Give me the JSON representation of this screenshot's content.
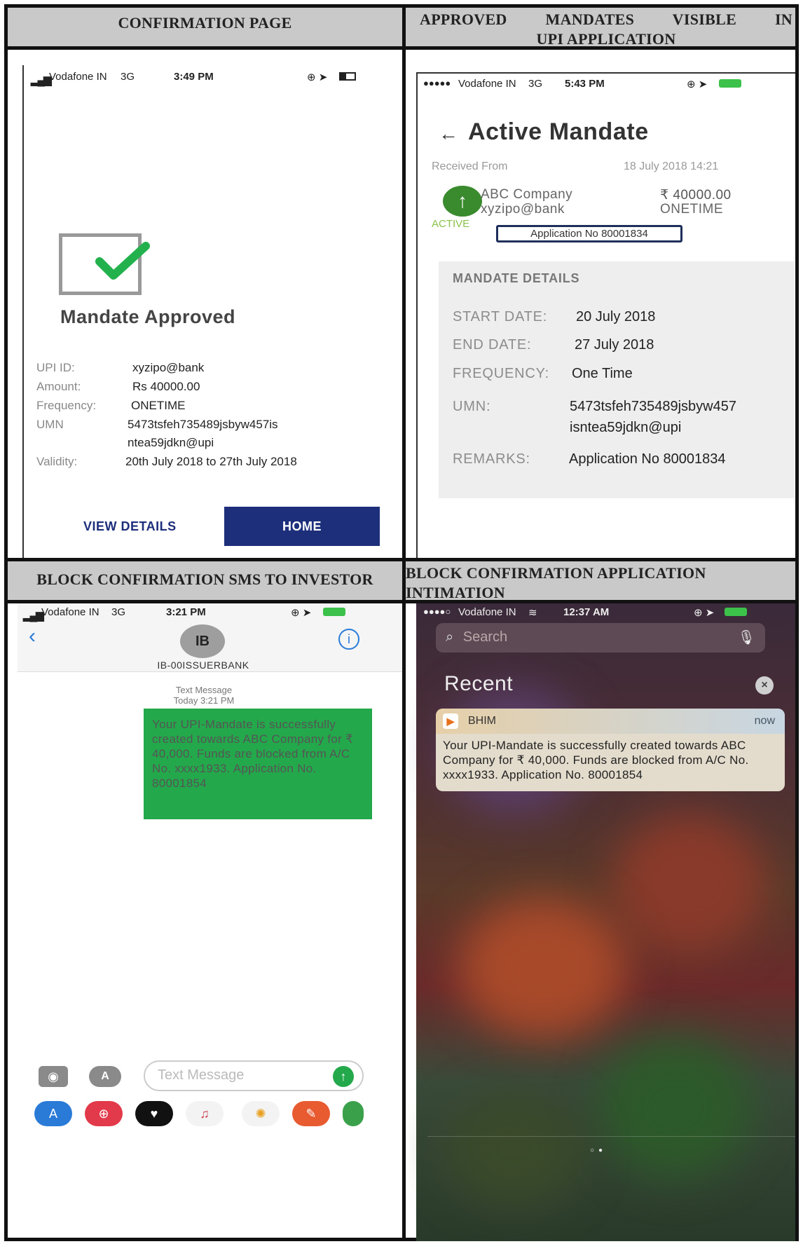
{
  "headers": {
    "top_left": "CONFIRMATION PAGE",
    "top_right_line1": "APPROVED MANDATES VISIBLE IN",
    "top_right_line2": "UPI APPLICATION",
    "bottom_left": "BLOCK CONFIRMATION SMS TO INVESTOR",
    "bottom_right_line1": "BLOCK CONFIRMATION APPLICATION",
    "bottom_right_line2": "INTIMATION"
  },
  "confirmation": {
    "status": {
      "carrier": "Vodafone IN",
      "network": "3G",
      "time": "3:49 PM"
    },
    "title": "Mandate Approved",
    "rows": [
      {
        "label": "UPI ID:",
        "value": "xyzipo@bank"
      },
      {
        "label": "Amount:",
        "value": "Rs 40000.00"
      },
      {
        "label": "Frequency:",
        "value": "ONETIME"
      },
      {
        "label": "UMN",
        "value": "5473tsfeh735489jsbyw457is"
      }
    ],
    "umn_cont": "ntea59jdkn@upi",
    "validity_label": "Validity:",
    "validity_value": "20th July 2018 to 27th July 2018",
    "view_details": "VIEW DETAILS",
    "home": "HOME"
  },
  "active_mandate": {
    "status": {
      "carrier": "Vodafone IN",
      "network": "3G",
      "time": "5:43 PM"
    },
    "title": "Active Mandate",
    "received_from": "Received From",
    "received_date": "18 July 2018 14:21",
    "payee_name": "ABC Company",
    "payee_upi": "xyzipo@bank",
    "amount": "₹ 40000.00",
    "frequency": "ONETIME",
    "state": "ACTIVE",
    "application": "Application No 80001834",
    "details_title": "MANDATE DETAILS",
    "details": {
      "start_label": "START DATE:",
      "start_value": "20 July 2018",
      "end_label": "END DATE:",
      "end_value": "27 July 2018",
      "freq_label": "FREQUENCY:",
      "freq_value": "One Time",
      "umn_label": "UMN:",
      "umn_value1": "5473tsfeh735489jsbyw457",
      "umn_value2": "isntea59jdkn@upi",
      "remarks_label": "REMARKS:",
      "remarks_value": "Application No 80001834"
    }
  },
  "sms": {
    "status": {
      "carrier": "Vodafone IN",
      "network": "3G",
      "time": "3:21 PM"
    },
    "avatar": "IB",
    "sender": "IB-00ISSUERBANK",
    "meta1": "Text Message",
    "meta2": "Today 3:21 PM",
    "message": "Your UPI-Mandate is successfully created towards ABC Company for ₹ 40,000. Funds are blocked from A/C No. xxxx1933. Application No. 80001854",
    "input_placeholder": "Text Message"
  },
  "notification": {
    "status": {
      "carrier": "Vodafone IN",
      "time": "12:37 AM"
    },
    "search_placeholder": "Search",
    "recent": "Recent",
    "app": "BHIM",
    "when": "now",
    "message": "Your UPI-Mandate is successfully created towards ABC Company for ₹ 40,000. Funds are blocked from A/C No. xxxx1933. Application No. 80001854"
  },
  "colors": {
    "header_gray": "#c9c9c9",
    "navy": "#1d2f7a",
    "green": "#23a94b",
    "check_green": "#22b14c"
  }
}
